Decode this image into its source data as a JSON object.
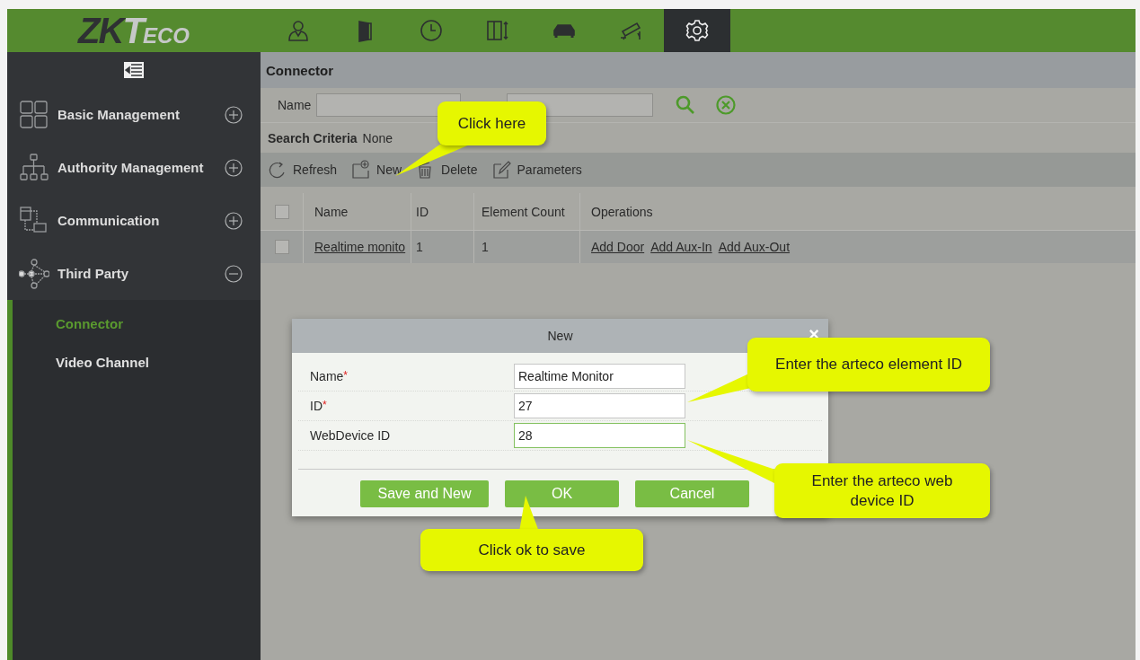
{
  "logo": {
    "part_1": "ZK",
    "part_2": "T",
    "part_3": "ECO"
  },
  "nav_tabs": [
    {
      "kind": "person",
      "selected": false
    },
    {
      "kind": "door",
      "selected": false
    },
    {
      "kind": "clock",
      "selected": false
    },
    {
      "kind": "elevator",
      "selected": false
    },
    {
      "kind": "car",
      "selected": false
    },
    {
      "kind": "camera",
      "selected": false
    },
    {
      "kind": "gear",
      "selected": true
    }
  ],
  "sidebar": {
    "items": [
      {
        "label": "Basic Management",
        "kind": "grid",
        "expanded": false
      },
      {
        "label": "Authority Management",
        "kind": "tree",
        "expanded": false
      },
      {
        "label": "Communication",
        "kind": "comm",
        "expanded": false
      },
      {
        "label": "Third Party",
        "kind": "network",
        "expanded": true,
        "children": [
          {
            "label": "Connector",
            "selected": true
          },
          {
            "label": "Video Channel",
            "selected": false
          }
        ]
      }
    ]
  },
  "page_title": "Connector",
  "search": {
    "label": "Name",
    "criteria_label": "Search Criteria",
    "criteria_value": "None"
  },
  "toolbar": [
    {
      "label": "Refresh",
      "kind": "refresh"
    },
    {
      "label": "New",
      "kind": "new"
    },
    {
      "label": "Delete",
      "kind": "delete"
    },
    {
      "label": "Parameters",
      "kind": "edit"
    }
  ],
  "table": {
    "columns": [
      "Name",
      "ID",
      "Element Count",
      "Operations"
    ],
    "header_checked": false,
    "rows": [
      {
        "checked": false,
        "name": "Realtime monito",
        "id": "1",
        "element_count": "1",
        "operations": [
          "Add Door",
          "Add Aux-In",
          "Add Aux-Out"
        ]
      }
    ]
  },
  "dialog": {
    "title": "New",
    "close": "×",
    "fields": [
      {
        "label": "Name",
        "required_mark": "*",
        "value": "Realtime Monitor",
        "focused": false
      },
      {
        "label": "ID",
        "required_mark": "*",
        "value": "27",
        "focused": false
      },
      {
        "label": "WebDevice ID",
        "value": "28",
        "focused": true
      }
    ],
    "buttons": [
      "Save and New",
      "OK",
      "Cancel"
    ]
  },
  "callouts": [
    "Click here",
    "Enter the arteco element ID",
    "Enter the arteco web device ID",
    "Click ok to save"
  ]
}
